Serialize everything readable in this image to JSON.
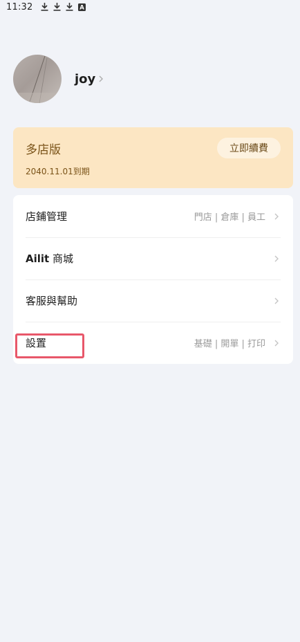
{
  "status_bar": {
    "time": "11:32",
    "icons": [
      "download-icon",
      "download-icon",
      "download-icon",
      "a-badge-icon"
    ],
    "badge_letter": "A"
  },
  "profile": {
    "name": "joy"
  },
  "plan": {
    "name": "多店版",
    "expiry": "2040.11.01到期",
    "renew_label": "立即續費",
    "colors": {
      "card_bg": "#fce6c3",
      "text": "#7a5318"
    }
  },
  "menu": {
    "items": [
      {
        "label": "店鋪管理",
        "sub": "門店 | 倉庫 | 員工"
      },
      {
        "label_strong": "Ailit",
        "label": " 商城",
        "sub": ""
      },
      {
        "label": "客服與幫助",
        "sub": ""
      },
      {
        "label": "設置",
        "sub": "基礎 | 開單 | 打印"
      }
    ]
  },
  "highlight": {
    "color": "#e8576a",
    "target": "menu-item-settings"
  }
}
